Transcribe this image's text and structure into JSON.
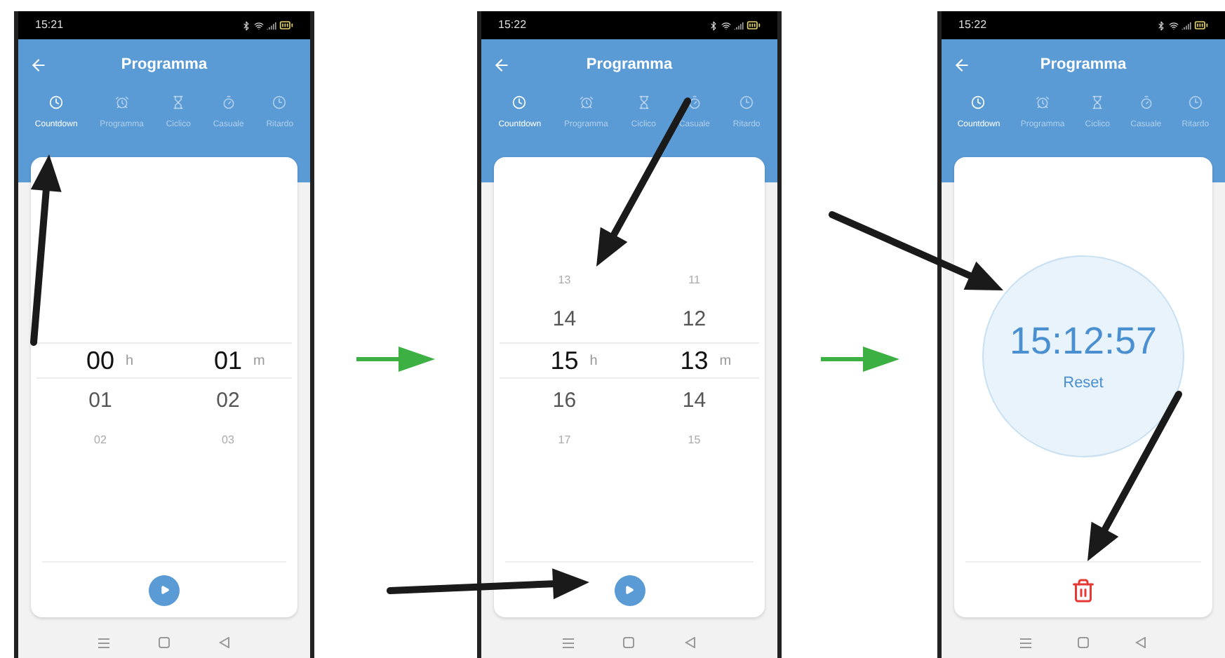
{
  "phones": [
    {
      "status_time": "15:21",
      "title": "Programma",
      "tabs": [
        {
          "label": "Countdown",
          "selected": true
        },
        {
          "label": "Programma",
          "selected": false
        },
        {
          "label": "Ciclico",
          "selected": false
        },
        {
          "label": "Casuale",
          "selected": false
        },
        {
          "label": "Ritardo",
          "selected": false
        }
      ],
      "content": {
        "kind": "picker",
        "columns": [
          {
            "unit": "h",
            "rows": [
              {
                "value": "00",
                "selected": true
              },
              {
                "value": "01",
                "selected": false
              },
              {
                "value": "02",
                "selected": false
              }
            ]
          },
          {
            "unit": "m",
            "rows": [
              {
                "value": "01",
                "selected": true
              },
              {
                "value": "02",
                "selected": false
              },
              {
                "value": "03",
                "selected": false
              }
            ]
          }
        ]
      },
      "footer": {
        "kind": "play"
      }
    },
    {
      "status_time": "15:22",
      "title": "Programma",
      "tabs": [
        {
          "label": "Countdown",
          "selected": true
        },
        {
          "label": "Programma",
          "selected": false
        },
        {
          "label": "Ciclico",
          "selected": false
        },
        {
          "label": "Casuale",
          "selected": false
        },
        {
          "label": "Ritardo",
          "selected": false
        }
      ],
      "content": {
        "kind": "picker",
        "columns": [
          {
            "unit": "h",
            "rows": [
              {
                "value": "13",
                "selected": false
              },
              {
                "value": "14",
                "selected": false
              },
              {
                "value": "15",
                "selected": true
              },
              {
                "value": "16",
                "selected": false
              },
              {
                "value": "17",
                "selected": false
              }
            ]
          },
          {
            "unit": "m",
            "rows": [
              {
                "value": "11",
                "selected": false
              },
              {
                "value": "12",
                "selected": false
              },
              {
                "value": "13",
                "selected": true
              },
              {
                "value": "14",
                "selected": false
              },
              {
                "value": "15",
                "selected": false
              }
            ]
          }
        ]
      },
      "footer": {
        "kind": "play"
      }
    },
    {
      "status_time": "15:22",
      "title": "Programma",
      "tabs": [
        {
          "label": "Countdown",
          "selected": true
        },
        {
          "label": "Programma",
          "selected": false
        },
        {
          "label": "Ciclico",
          "selected": false
        },
        {
          "label": "Casuale",
          "selected": false
        },
        {
          "label": "Ritardo",
          "selected": false
        }
      ],
      "content": {
        "kind": "timer",
        "time": "15:12:57",
        "action": "Reset"
      },
      "footer": {
        "kind": "delete"
      }
    }
  ]
}
